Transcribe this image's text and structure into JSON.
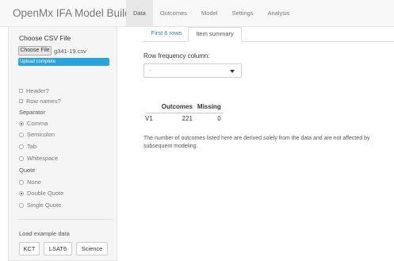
{
  "app": {
    "brand": "OpenMx IFA Model Builder",
    "nav_tabs": [
      {
        "label": "Data",
        "active": true
      },
      {
        "label": "Outcomes",
        "active": false
      },
      {
        "label": "Model",
        "active": false
      },
      {
        "label": "Settings",
        "active": false
      },
      {
        "label": "Analysis",
        "active": false
      }
    ]
  },
  "sidebar": {
    "choose_label": "Choose CSV File",
    "browse_label": "Choose File",
    "file_name": "g341-19.csv",
    "upload_status": "Upload complete",
    "upload_progress": 1.0,
    "header_label": "Header?",
    "rownames_label": "Row names?",
    "separator_label": "Separator",
    "separator_options": [
      {
        "label": "Comma",
        "checked": true
      },
      {
        "label": "Semicolon",
        "checked": false
      },
      {
        "label": "Tab",
        "checked": false
      },
      {
        "label": "Whitespace",
        "checked": false
      }
    ],
    "quote_label": "Quote",
    "quote_options": [
      {
        "label": "None",
        "checked": false
      },
      {
        "label": "Double Quote",
        "checked": true
      },
      {
        "label": "Single Quote",
        "checked": false
      }
    ],
    "example_label": "Load example data",
    "example_buttons": [
      "KCT",
      "LSAT6",
      "Science"
    ]
  },
  "main": {
    "sub_tabs": [
      {
        "label": "First 6 rows",
        "active": false
      },
      {
        "label": "Item summary",
        "active": true
      }
    ],
    "freq_label": "Row frequency column:",
    "freq_value": "-",
    "table": {
      "headers": [
        "",
        "Outcomes",
        "Missing"
      ],
      "rows": [
        [
          "V1",
          "221",
          "0"
        ]
      ]
    },
    "note": "The number of outcomes listed here are derived solely from the data and are not affected by subsequent modeling."
  }
}
